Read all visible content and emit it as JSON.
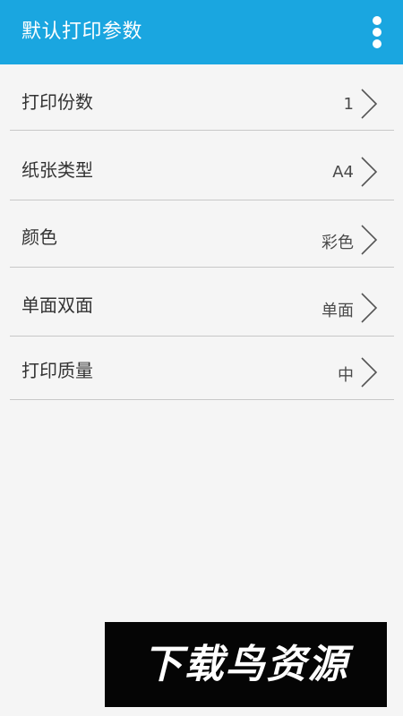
{
  "app_bar": {
    "title": "默认打印参数",
    "menu_icon": "overflow-menu-icon",
    "background_color": "#1aa6e0"
  },
  "settings": [
    {
      "label": "打印份数",
      "value": "1"
    },
    {
      "label": "纸张类型",
      "value": "A4"
    },
    {
      "label": "颜色",
      "value": "彩色"
    },
    {
      "label": "单面双面",
      "value": "单面"
    },
    {
      "label": "打印质量",
      "value": "中"
    }
  ],
  "watermark": {
    "text": "下载鸟资源"
  }
}
